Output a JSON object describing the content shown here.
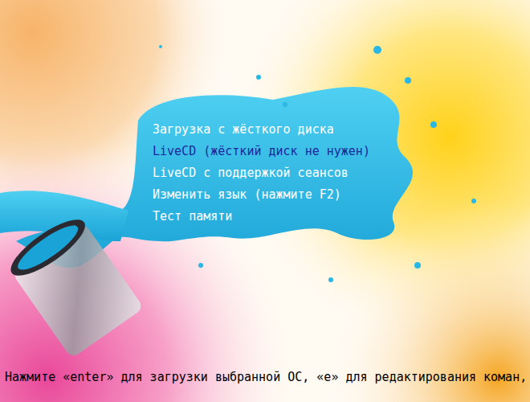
{
  "menu": {
    "items": [
      {
        "label": "Загрузка с жёсткого диска",
        "selected": false
      },
      {
        "label": "LiveCD (жёсткий диск не нужен)",
        "selected": true
      },
      {
        "label": "LiveCD с поддержкой сеансов",
        "selected": false
      },
      {
        "label": "Изменить язык (нажмите F2)",
        "selected": false
      },
      {
        "label": "Тест памяти",
        "selected": false
      }
    ]
  },
  "hint": "Нажмите «enter» для загрузки выбранной ОС, «е» для редактирования коман,"
}
